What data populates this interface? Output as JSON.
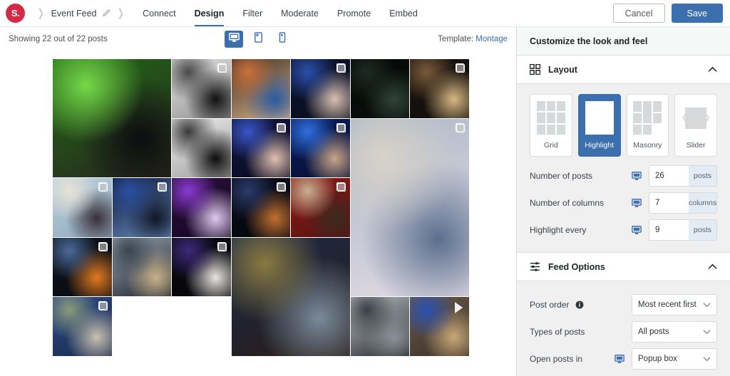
{
  "topbar": {
    "logo_text": "S.",
    "breadcrumb": "Event Feed",
    "edit_icon": "pencil-icon",
    "nav": [
      {
        "label": "Connect",
        "active": false
      },
      {
        "label": "Design",
        "active": true
      },
      {
        "label": "Filter",
        "active": false
      },
      {
        "label": "Moderate",
        "active": false
      },
      {
        "label": "Promote",
        "active": false
      },
      {
        "label": "Embed",
        "active": false
      }
    ],
    "cancel_label": "Cancel",
    "save_label": "Save"
  },
  "preview": {
    "showing_text": "Showing 22 out of 22 posts",
    "devices": [
      {
        "name": "desktop-preview",
        "icon": "desktop-icon",
        "active": true
      },
      {
        "name": "tablet-preview",
        "icon": "tablet-icon",
        "active": false
      },
      {
        "name": "mobile-preview",
        "icon": "mobile-icon",
        "active": false
      }
    ],
    "template_label": "Template:",
    "template_value": "Montage"
  },
  "sidebar": {
    "heading": "Customize the look and feel",
    "layout_section": {
      "icon": "grid-icon",
      "title": "Layout",
      "collapse_icon": "chevron-up-icon",
      "options": [
        {
          "label": "Grid",
          "selected": false
        },
        {
          "label": "Highlight",
          "selected": true
        },
        {
          "label": "Masonry",
          "selected": false
        },
        {
          "label": "Slider",
          "selected": false
        }
      ],
      "fields": [
        {
          "label": "Number of posts",
          "value": "26",
          "unit": "posts",
          "device_icon": "desktop-icon"
        },
        {
          "label": "Number of columns",
          "value": "7",
          "unit": "columns",
          "device_icon": "desktop-icon"
        },
        {
          "label": "Highlight every",
          "value": "9",
          "unit": "posts",
          "device_icon": "desktop-icon"
        }
      ]
    },
    "feed_options_section": {
      "icon": "sliders-icon",
      "title": "Feed Options",
      "collapse_icon": "chevron-up-icon",
      "fields": [
        {
          "label": "Post order",
          "value": "Most recent first",
          "info_icon": "info-icon",
          "has_device_icon": false
        },
        {
          "label": "Types of posts",
          "value": "All posts",
          "has_device_icon": false
        },
        {
          "label": "Open posts in",
          "value": "Popup box",
          "device_icon": "desktop-icon",
          "has_device_icon": true
        }
      ]
    }
  },
  "colors": {
    "accent": "#3c6fae",
    "brand": "#d32b45",
    "sidebar_bg": "#f0f0f1",
    "border": "#dcdcde"
  },
  "grid": {
    "columns": 7,
    "cells": [
      {
        "id": "p1",
        "col": 1,
        "row": 1,
        "cspan": 2,
        "rspan": 2,
        "badge": "none",
        "c1": "#1f6b14",
        "c2": "#76d84a",
        "c3": "#0d0c10",
        "c4": "#2a2420",
        "kind": "portrait-green"
      },
      {
        "id": "p2",
        "col": 3,
        "row": 1,
        "cspan": 1,
        "rspan": 1,
        "badge": "stack",
        "c1": "#e8e8e8",
        "c2": "#4a4a4a",
        "c3": "#111111",
        "c4": "#8d8d8d",
        "kind": "bw-guitar"
      },
      {
        "id": "p3",
        "col": 4,
        "row": 1,
        "cspan": 1,
        "rspan": 1,
        "badge": "none",
        "c1": "#3b2c20",
        "c2": "#c96f3a",
        "c3": "#2a5aa0",
        "c4": "#d8b28a",
        "kind": "guitarist-curly"
      },
      {
        "id": "p4",
        "col": 5,
        "row": 1,
        "cspan": 1,
        "rspan": 1,
        "badge": "stack",
        "c1": "#0b1430",
        "c2": "#2b4fa8",
        "c3": "#d8c0b4",
        "c4": "#0a0d1c",
        "kind": "singer-blue"
      },
      {
        "id": "p5",
        "col": 6,
        "row": 1,
        "cspan": 1,
        "rspan": 1,
        "badge": "none",
        "c1": "#050806",
        "c2": "#1d2b22",
        "c3": "#2f4438",
        "c4": "#0a0f0c",
        "kind": "dark-silhouette"
      },
      {
        "id": "p6",
        "col": 7,
        "row": 1,
        "cspan": 1,
        "rspan": 1,
        "badge": "stack",
        "c1": "#1a1410",
        "c2": "#7a5a3a",
        "c3": "#d8b882",
        "c4": "#120e0b",
        "kind": "rapper-crowd"
      },
      {
        "id": "p7",
        "col": 3,
        "row": 2,
        "cspan": 1,
        "rspan": 1,
        "badge": "none",
        "c1": "#f2f2f2",
        "c2": "#3a3a3a",
        "c3": "#0d0d0d",
        "c4": "#9a9a9a",
        "kind": "bw-stage"
      },
      {
        "id": "p8",
        "col": 4,
        "row": 2,
        "cspan": 1,
        "rspan": 1,
        "badge": "stack",
        "c1": "#11143a",
        "c2": "#3a56c8",
        "c3": "#e0c0b0",
        "c4": "#090b22",
        "kind": "singer-vest"
      },
      {
        "id": "p9",
        "col": 5,
        "row": 2,
        "cspan": 1,
        "rspan": 1,
        "badge": "stack",
        "c1": "#0a1f5e",
        "c2": "#2f6fe0",
        "c3": "#c8a58a",
        "c4": "#060d2e",
        "kind": "crowd-blue"
      },
      {
        "id": "p10",
        "col": 6,
        "row": 2,
        "cspan": 2,
        "rspan": 3,
        "badge": "stack",
        "c1": "#a8b4c4",
        "c2": "#d8d2c8",
        "c3": "#5a6f8e",
        "c4": "#e8dfe8",
        "kind": "festival-bucket-hat"
      },
      {
        "id": "p11",
        "col": 1,
        "row": 3,
        "cspan": 1,
        "rspan": 1,
        "badge": "stack",
        "c1": "#bcd2e0",
        "c2": "#e8e2d4",
        "c3": "#3a3038",
        "c4": "#8fa8bc",
        "kind": "person-tablet"
      },
      {
        "id": "p12",
        "col": 2,
        "row": 3,
        "cspan": 1,
        "rspan": 1,
        "badge": "stack",
        "c1": "#0b1430",
        "c2": "#2a4fa0",
        "c3": "#101828",
        "c4": "#6a8cc0",
        "kind": "performer-hood"
      },
      {
        "id": "p13",
        "col": 3,
        "row": 3,
        "cspan": 1,
        "rspan": 1,
        "badge": "none",
        "c1": "#2a0f3e",
        "c2": "#8a3ad0",
        "c3": "#e0c8f0",
        "c4": "#14061f",
        "kind": "stage-purple"
      },
      {
        "id": "p14",
        "col": 4,
        "row": 3,
        "cspan": 1,
        "rspan": 1,
        "badge": "stack",
        "c1": "#0a0d18",
        "c2": "#2a3a6a",
        "c3": "#c07030",
        "c4": "#05060c",
        "kind": "night-drones"
      },
      {
        "id": "p15",
        "col": 5,
        "row": 3,
        "cspan": 1,
        "rspan": 1,
        "badge": "stack",
        "c1": "#8a1a18",
        "c2": "#c8b090",
        "c3": "#3a2a20",
        "c4": "#5a1210",
        "kind": "red-seats"
      },
      {
        "id": "p16",
        "col": 1,
        "row": 4,
        "cspan": 1,
        "rspan": 1,
        "badge": "stack",
        "c1": "#10141c",
        "c2": "#4a6a9a",
        "c3": "#e07a20",
        "c4": "#080a10",
        "kind": "guitarist-orange"
      },
      {
        "id": "p17",
        "col": 2,
        "row": 4,
        "cspan": 1,
        "rspan": 1,
        "badge": "none",
        "c1": "#9aa6b4",
        "c2": "#3a4450",
        "c3": "#c8b088",
        "c4": "#1c2028",
        "kind": "backstage"
      },
      {
        "id": "p18",
        "col": 3,
        "row": 4,
        "cspan": 1,
        "rspan": 1,
        "badge": "stack",
        "c1": "#0a0a10",
        "c2": "#3a2a7a",
        "c3": "#e8e4e0",
        "c4": "#050508",
        "kind": "white-shirt-dark"
      },
      {
        "id": "p19",
        "col": 4,
        "row": 4,
        "cspan": 2,
        "rspan": 2,
        "badge": "none",
        "c1": "#1a2a4a",
        "c2": "#8a7a40",
        "c3": "#7a8a9a",
        "c4": "#2a1c14",
        "kind": "jeans-presenter"
      },
      {
        "id": "p20",
        "col": 6,
        "row": 5,
        "cspan": 1,
        "rspan": 1,
        "badge": "none",
        "c1": "#c0c4c8",
        "c2": "#3a4048",
        "c3": "#8a9098",
        "c4": "#20242a",
        "kind": "expo-crowd"
      },
      {
        "id": "p21",
        "col": 7,
        "row": 5,
        "cspan": 1,
        "rspan": 1,
        "badge": "play",
        "c1": "#6a5a48",
        "c2": "#2a50b0",
        "c3": "#c8a878",
        "c4": "#3a3028",
        "kind": "expo-walk-video"
      },
      {
        "id": "p22",
        "col": 1,
        "row": 5,
        "cspan": 1,
        "rspan": 1,
        "badge": "stack",
        "c1": "#2a4a8a",
        "c2": "#8a9a7a",
        "c3": "#c8c0b0",
        "c4": "#1a2a4a",
        "kind": "warehouse-jeans"
      }
    ]
  }
}
